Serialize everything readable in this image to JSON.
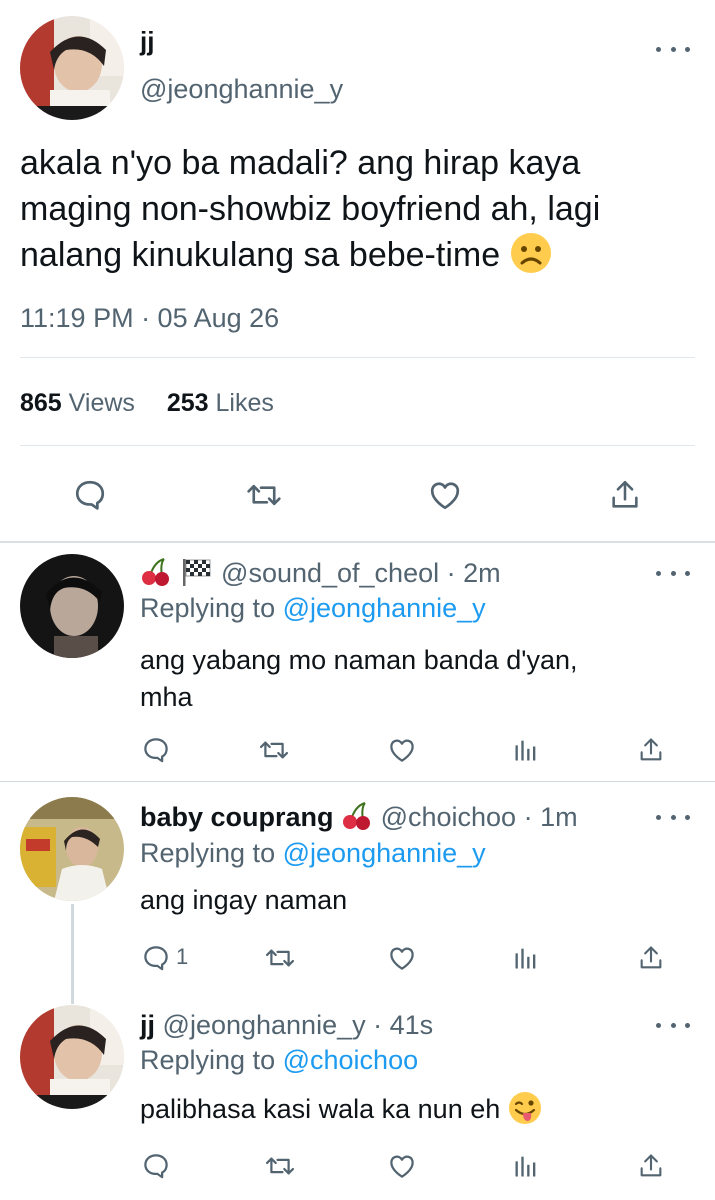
{
  "main_tweet": {
    "display_name": "jj",
    "handle": "@jeonghannie_y",
    "text_lines": [
      "akala n'yo ba madali? ang hirap kaya",
      "maging non-showbiz boyfriend ah, lagi",
      "nalang kinukulang sa bebe-time"
    ],
    "emoji": "☹",
    "timestamp": "11:19 PM · 05 Aug 26",
    "views_count": "865",
    "views_label": "Views",
    "likes_count": "253",
    "likes_label": "Likes"
  },
  "replies": [
    {
      "display_name": "",
      "badge_emojis": [
        "🍒",
        "🏁"
      ],
      "handle": "@sound_of_cheol",
      "time": "· 2m",
      "replying_prefix": "Replying to",
      "replying_to": "@jeonghannie_y",
      "text_lines": [
        "ang yabang mo naman banda d'yan,",
        "mha"
      ],
      "reply_count": ""
    },
    {
      "display_name": "baby couprang",
      "badge_emojis": [
        "🍒"
      ],
      "handle": "@choichoo",
      "time": "· 1m",
      "replying_prefix": "Replying to",
      "replying_to": "@jeonghannie_y",
      "text_lines": [
        "ang ingay naman"
      ],
      "reply_count": "1"
    },
    {
      "display_name": "jj",
      "badge_emojis": [],
      "handle": "@jeonghannie_y",
      "time": "· 41s",
      "replying_prefix": "Replying to",
      "replying_to": "@choichoo",
      "text_lines": [
        "palibhasa kasi wala ka nun eh"
      ],
      "emoji": "😜",
      "reply_count": ""
    }
  ],
  "icons": {
    "reply": "reply-icon",
    "retweet": "retweet-icon",
    "like": "heart-icon",
    "views": "analytics-icon",
    "share": "share-icon",
    "more": "more-icon"
  },
  "colors": {
    "text": "#0f1419",
    "muted": "#536471",
    "link": "#1d9bf0",
    "divider": "#cfd9de"
  }
}
